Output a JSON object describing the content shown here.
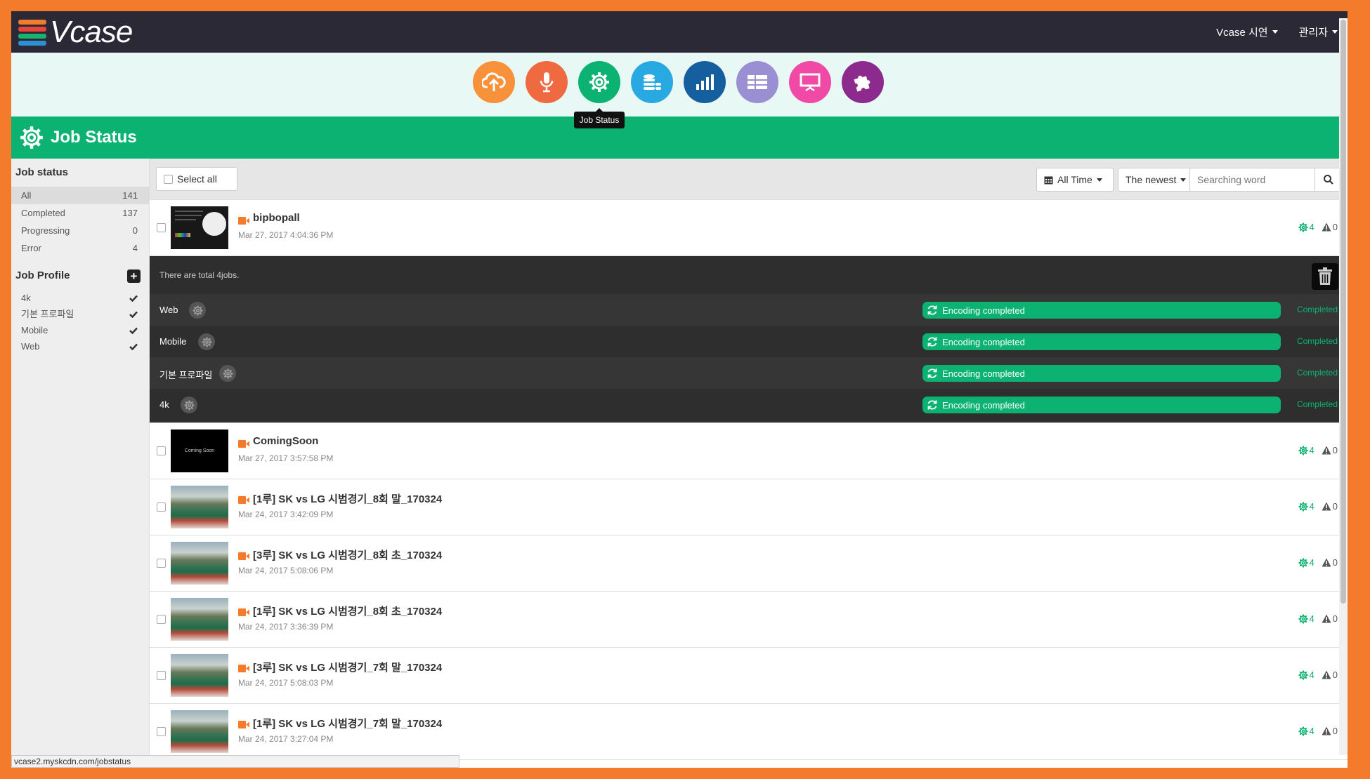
{
  "app": {
    "logo_text": "Vcase",
    "logo_colors": [
      "#f47a2c",
      "#e8453c",
      "#1ab26b",
      "#2d8fd6"
    ],
    "menu": [
      {
        "label": "Vcase 시연"
      },
      {
        "label": "관리자"
      }
    ]
  },
  "app_icons": [
    {
      "name": "upload-cloud-icon",
      "color": "#f7913a"
    },
    {
      "name": "microphone-icon",
      "color": "#ef6a40"
    },
    {
      "name": "gear-icon",
      "color": "#0bb272",
      "active": true
    },
    {
      "name": "database-icon",
      "color": "#29a9e1"
    },
    {
      "name": "bar-chart-icon",
      "color": "#155f9e"
    },
    {
      "name": "list-icon",
      "color": "#9a8fd3"
    },
    {
      "name": "presentation-icon",
      "color": "#f04aa6"
    },
    {
      "name": "puzzle-icon",
      "color": "#8d2a8e"
    }
  ],
  "tooltip": "Job Status",
  "page_title": "Job Status",
  "sidebar": {
    "status_heading": "Job status",
    "status_items": [
      {
        "label": "All",
        "count": "141",
        "active": true
      },
      {
        "label": "Completed",
        "count": "137"
      },
      {
        "label": "Progressing",
        "count": "0"
      },
      {
        "label": "Error",
        "count": "4"
      }
    ],
    "profile_heading": "Job Profile",
    "profiles": [
      {
        "label": "4k"
      },
      {
        "label": "기본 프로파일"
      },
      {
        "label": "Mobile"
      },
      {
        "label": "Web"
      }
    ]
  },
  "toolbar": {
    "select_all": "Select all",
    "time_filter": "All Time",
    "sort": "The newest",
    "search_placeholder": "Searching word"
  },
  "expanded": {
    "total_text": "There are total 4jobs.",
    "profiles": [
      {
        "name": "Web",
        "progress_label": "Encoding completed",
        "status": "Completed",
        "progress": 1.0
      },
      {
        "name": "Mobile",
        "progress_label": "Encoding completed",
        "status": "Completed",
        "progress": 1.0
      },
      {
        "name": "기본 프로파일",
        "progress_label": "Encoding completed",
        "status": "Completed",
        "progress": 1.0
      },
      {
        "name": "4k",
        "progress_label": "Encoding completed",
        "status": "Completed",
        "progress": 1.0
      }
    ]
  },
  "jobs": [
    {
      "title": "bipbopall",
      "date": "Mar 27, 2017 4:04:36 PM",
      "ok": "4",
      "err": "0",
      "thumb": "pie"
    },
    {
      "title": "ComingSoon",
      "date": "Mar 27, 2017 3:57:58 PM",
      "ok": "4",
      "err": "0",
      "thumb": "coming",
      "thumb_text": "Coming Soon"
    },
    {
      "title": "[1루] SK vs LG 시범경기_8회 말_170324",
      "date": "Mar 24, 2017 3:42:09 PM",
      "ok": "4",
      "err": "0",
      "thumb": "stadium"
    },
    {
      "title": "[3루] SK vs LG 시범경기_8회 초_170324",
      "date": "Mar 24, 2017 5:08:06 PM",
      "ok": "4",
      "err": "0",
      "thumb": "stadium"
    },
    {
      "title": "[1루] SK vs LG 시범경기_8회 초_170324",
      "date": "Mar 24, 2017 3:36:39 PM",
      "ok": "4",
      "err": "0",
      "thumb": "stadium"
    },
    {
      "title": "[3루] SK vs LG 시범경기_7회 말_170324",
      "date": "Mar 24, 2017 5:08:03 PM",
      "ok": "4",
      "err": "0",
      "thumb": "stadium"
    },
    {
      "title": "[1루] SK vs LG 시범경기_7회 말_170324",
      "date": "Mar 24, 2017 3:27:04 PM",
      "ok": "4",
      "err": "0",
      "thumb": "stadium"
    }
  ],
  "status_url": "vcase2.myskcdn.com/jobstatus"
}
